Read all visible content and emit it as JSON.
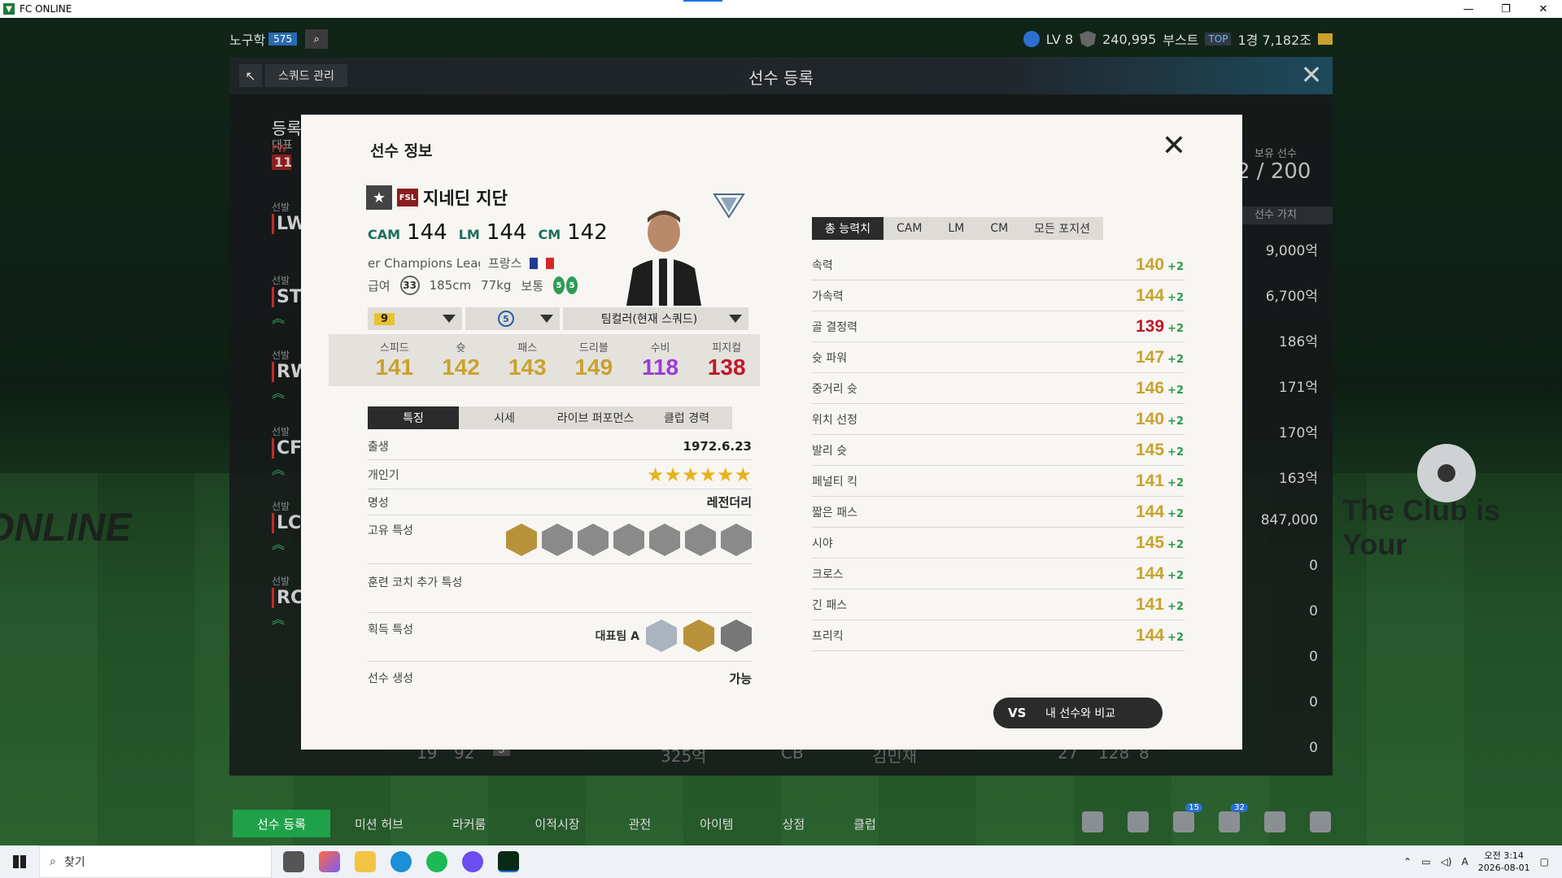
{
  "window": {
    "title": "FC ONLINE"
  },
  "topbar": {
    "username": "노구학",
    "user_badge": "575",
    "level": "LV 8",
    "points": "240,995",
    "boost_label": "부스트",
    "boost_badge": "TOP",
    "currency": "1경 7,182조"
  },
  "register_panel": {
    "back_label": "스쿼드 관리",
    "title": "선수 등록",
    "left": {
      "heading": "등록",
      "subheading": "대표팀",
      "positions": [
        {
          "label": "FW",
          "code": "11"
        },
        {
          "label": "선발",
          "code": "LW"
        },
        {
          "label": "선발",
          "code": "ST"
        },
        {
          "label": "선발",
          "code": "RW"
        },
        {
          "label": "선발",
          "code": "CF"
        },
        {
          "label": "선발",
          "code": "LC"
        },
        {
          "label": "선발",
          "code": "RC"
        }
      ]
    },
    "right": {
      "owned_label": "보유 선수",
      "owned_value": "2 / 200",
      "value_header": "선수 가치",
      "values": [
        "9,000억",
        "6,700억",
        "186억",
        "171억",
        "170억",
        "163억",
        "847,000",
        "0",
        "0",
        "0",
        "0",
        "0"
      ]
    },
    "bottom_row": {
      "ovr": "19",
      "rating": "92",
      "lvl": "5",
      "price": "325억",
      "pos": "CB",
      "name": "김민재",
      "c1": "27",
      "c2": "128",
      "c3": "8"
    }
  },
  "modal": {
    "title": "선수 정보",
    "player": {
      "season": "FSL",
      "name": "지네딘 지단",
      "ovrs": [
        {
          "pos": "CAM",
          "value": "144"
        },
        {
          "pos": "LM",
          "value": "144"
        },
        {
          "pos": "CM",
          "value": "142"
        }
      ],
      "league": "er Champions League",
      "nation": "프랑스",
      "salary_label": "급여",
      "salary": "33",
      "height": "185cm",
      "weight": "77kg",
      "body": "보통",
      "foot_left": "5",
      "foot_right": "5"
    },
    "selects": {
      "level": "9",
      "enhance": "5",
      "team_color": "팀컬러(현재 스쿼드)"
    },
    "summary_stats": [
      {
        "label": "스피드",
        "value": "141",
        "color": "#c9a22e"
      },
      {
        "label": "슛",
        "value": "142",
        "color": "#c9a22e"
      },
      {
        "label": "패스",
        "value": "143",
        "color": "#c9a22e"
      },
      {
        "label": "드리블",
        "value": "149",
        "color": "#c9a22e"
      },
      {
        "label": "수비",
        "value": "118",
        "color": "#9a3cd6"
      },
      {
        "label": "피지컬",
        "value": "138",
        "color": "#c0182a"
      }
    ],
    "info_tabs": [
      "특징",
      "시세",
      "라이브 퍼포먼스",
      "클럽 경력"
    ],
    "info": {
      "birth_label": "출생",
      "birth": "1972.6.23",
      "popularity_label": "개인기",
      "reputation_label": "명성",
      "reputation": "레전더리",
      "traits_label": "고유 특성",
      "coach_label": "훈련 코치 추가 특성",
      "acquired_label": "획득 특성",
      "acquired_value": "대표팀 A",
      "creation_label": "선수 생성",
      "creation": "가능"
    },
    "attr_tabs": [
      "총 능력치",
      "CAM",
      "LM",
      "CM",
      "모든 포지션"
    ],
    "attributes": [
      {
        "name": "속력",
        "value": "140",
        "bonus": "+2",
        "color": "#c9a22e"
      },
      {
        "name": "가속력",
        "value": "144",
        "bonus": "+2",
        "color": "#c9a22e"
      },
      {
        "name": "골 결정력",
        "value": "139",
        "bonus": "+2",
        "color": "#c0182a"
      },
      {
        "name": "슛 파워",
        "value": "147",
        "bonus": "+2",
        "color": "#c9a22e"
      },
      {
        "name": "중거리 슛",
        "value": "146",
        "bonus": "+2",
        "color": "#c9a22e"
      },
      {
        "name": "위치 선정",
        "value": "140",
        "bonus": "+2",
        "color": "#c9a22e"
      },
      {
        "name": "발리 슛",
        "value": "145",
        "bonus": "+2",
        "color": "#c9a22e"
      },
      {
        "name": "페널티 킥",
        "value": "141",
        "bonus": "+2",
        "color": "#c9a22e"
      },
      {
        "name": "짧은 패스",
        "value": "144",
        "bonus": "+2",
        "color": "#c9a22e"
      },
      {
        "name": "시야",
        "value": "145",
        "bonus": "+2",
        "color": "#c9a22e"
      },
      {
        "name": "크로스",
        "value": "144",
        "bonus": "+2",
        "color": "#c9a22e"
      },
      {
        "name": "긴 패스",
        "value": "141",
        "bonus": "+2",
        "color": "#c9a22e"
      },
      {
        "name": "프리킥",
        "value": "144",
        "bonus": "+2",
        "color": "#c9a22e"
      }
    ],
    "compare_button": "내 선수와 비교"
  },
  "bottom_nav": {
    "items": [
      "선수 등록",
      "미션 허브",
      "라커룸",
      "이적시장",
      "관전",
      "아이템",
      "상점",
      "클럽"
    ],
    "badges": {
      "home": "15",
      "bell": "32"
    }
  },
  "taskbar": {
    "search": "찾기",
    "time": "오전 3:14",
    "date": "2026-08-01",
    "ime": "A"
  }
}
